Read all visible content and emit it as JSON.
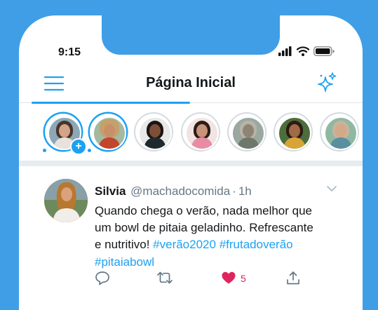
{
  "status_bar": {
    "time": "9:15"
  },
  "header": {
    "title": "Página Inicial"
  },
  "colors": {
    "accent": "#1da1f2",
    "background": "#3f9ee6",
    "like": "#e0245e"
  },
  "stories": [
    {
      "label": "your-story",
      "state": "active",
      "has_add": true
    },
    {
      "label": "story-2",
      "state": "active"
    },
    {
      "label": "story-3",
      "state": "seen"
    },
    {
      "label": "story-4",
      "state": "seen"
    },
    {
      "label": "story-5",
      "state": "seen"
    },
    {
      "label": "story-6",
      "state": "seen"
    },
    {
      "label": "story-7",
      "state": "seen"
    }
  ],
  "tweet": {
    "name": "Silvia",
    "handle": "@machadocomida",
    "separator": "·",
    "time": "1h",
    "text_line1": "Quando chega o verão, nada melhor que",
    "text_line2": "um bowl de pitaia geladinho. Refrescante",
    "text_line3_plain": "e nutritivo! ",
    "hashtag1": "#verão2020",
    "hashtag2": "#frutadoverão",
    "hashtag3": "#pitaiabowl",
    "likes": "5"
  },
  "icons": [
    "menu-icon",
    "sparkle-icon",
    "signal-icon",
    "wifi-icon",
    "battery-icon",
    "reply-icon",
    "retweet-icon",
    "heart-icon",
    "share-icon",
    "chevron-down-icon"
  ]
}
